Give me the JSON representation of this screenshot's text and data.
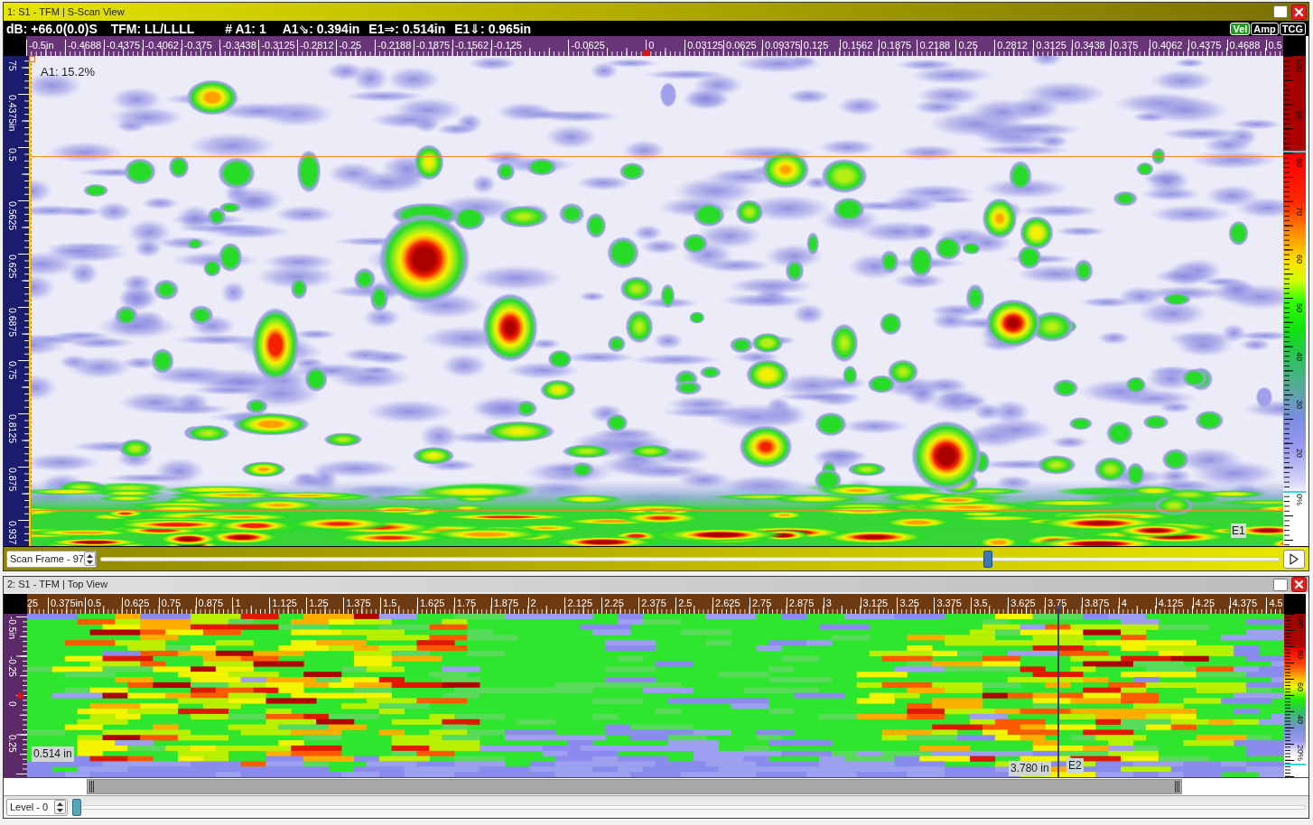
{
  "s_scan_window": {
    "title": "1: S1 - TFM | S-Scan View",
    "readouts": [
      "dB: +66.0(0.0)S",
      "TFM: LL/LLLL",
      "# A1: 1",
      "A1⇘: 0.394in",
      "E1⇒: 0.514in",
      "E1⇓: 0.965in"
    ],
    "mode_buttons": [
      {
        "label": "Vel",
        "selected": true
      },
      {
        "label": "Amp",
        "selected": false
      },
      {
        "label": "TCG",
        "selected": false
      }
    ],
    "horizontal_ruler": [
      "-0.5in",
      "-0.4688",
      "-0.4375",
      "-0.4062",
      "-0.375",
      "-0.3438",
      "-0.3125",
      "-0.2812",
      "-0.25",
      "-0.2188",
      "-0.1875",
      "-0.1562",
      "-0.125",
      "-0.0625",
      "0",
      "0.03125",
      "0.0625",
      "0.09375",
      "0.125",
      "0.1562",
      "0.1875",
      "0.2188",
      "0.25",
      "0.2812",
      "0.3125",
      "0.3438",
      "0.375",
      "0.4062",
      "0.4375",
      "0.4688",
      "0.5"
    ],
    "vertical_ruler": [
      "75",
      "0.4375in",
      "0.5",
      "0.5625",
      "0.625",
      "0.6875",
      "0.75",
      "0.8125",
      "0.875",
      "0.937"
    ],
    "amplitude_readout": "A1: 15.2%",
    "cursor_label": "E1",
    "color_scale": [
      "100",
      "90",
      "80",
      "70",
      "60",
      "50",
      "40",
      "30",
      "20",
      "0%"
    ],
    "scan_frame": {
      "label": "Scan Frame - 97",
      "level": 0.755
    }
  },
  "top_view_window": {
    "title": "2: S1 - TFM | Top View",
    "horizontal_ruler": [
      "25",
      "0.375in",
      "0.5",
      "0.625",
      "0.75",
      "0.875",
      "1",
      "1.125",
      "1.25",
      "1.375",
      "1.5",
      "1.625",
      "1.75",
      "1.875",
      "2",
      "2.125",
      "2.25",
      "2.375",
      "2.5",
      "2.625",
      "2.75",
      "2.875",
      "3",
      "3.125",
      "3.25",
      "3.375",
      "3.5",
      "3.625",
      "3.75",
      "3.875",
      "4",
      "4.125",
      "4.25",
      "4.375",
      "4.5"
    ],
    "vertical_ruler": [
      "-0.5in",
      "-0.25",
      "0",
      "0.25"
    ],
    "position_readout": "0.514 in",
    "cursor_readout": "3.780 in",
    "cursor_label": "E2",
    "color_scale": [
      "100",
      "80",
      "60",
      "40",
      "20%"
    ],
    "level_control": {
      "label": "Level - 0",
      "level": 0
    }
  }
}
